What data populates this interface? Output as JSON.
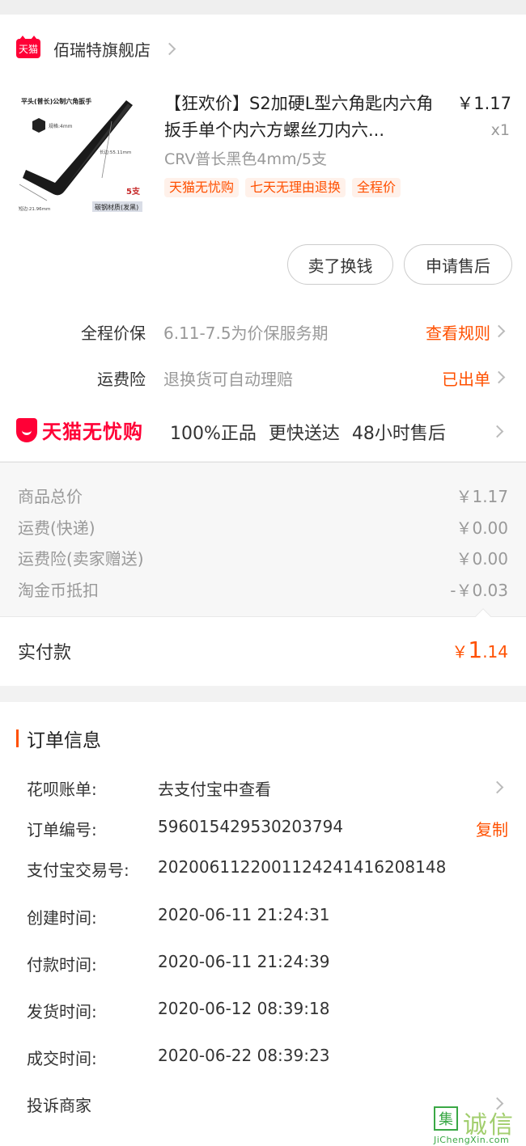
{
  "store": {
    "badge": "天猫",
    "name": "佰瑞特旗舰店"
  },
  "product": {
    "image_texts": {
      "heading": "平头(普长)公制六角扳手",
      "spec": "规格:4mm",
      "long_side": "长边:55.11mm",
      "short_side": "短边:21.96mm",
      "count": "5支",
      "material": "碳钢材质(发黑)"
    },
    "title": "【狂欢价】S2加硬L型六角匙内六角扳手单个内六方螺丝刀内六...",
    "price": "￥1.17",
    "qty": "x1",
    "sku": "CRV普长黑色4mm/5支",
    "tags": [
      "天猫无忧购",
      "七天无理由退换",
      "全程价"
    ]
  },
  "buttons": {
    "sell": "卖了换钱",
    "after_sale": "申请售后"
  },
  "services": [
    {
      "label": "全程价保",
      "desc": "6.11-7.5为价保服务期",
      "link": "查看规则"
    },
    {
      "label": "运费险",
      "desc": "退换货可自动理赔",
      "link": "已出单"
    }
  ],
  "wuyou": {
    "logo_text": "天猫无忧购",
    "features": "100%正品  更快送达  48小时售后"
  },
  "costs": [
    {
      "label": "商品总价",
      "value": "￥1.17"
    },
    {
      "label": "运费(快递)",
      "value": "￥0.00"
    },
    {
      "label": "运费险(卖家赠送)",
      "value": "￥0.00"
    },
    {
      "label": "淘金币抵扣",
      "value": "-￥0.03"
    }
  ],
  "paid": {
    "label": "实付款",
    "currency": "￥",
    "int": "1",
    "dec": ".14"
  },
  "order_info": {
    "title": "订单信息",
    "rows": [
      {
        "label": "花呗账单:",
        "value": "去支付宝中查看"
      },
      {
        "label": "订单编号:",
        "value": "596015429530203794",
        "action": "复制"
      },
      {
        "label": "支付宝交易号:",
        "value": "2020061122001124241416208148"
      },
      {
        "label": "创建时间:",
        "value": "2020-06-11 21:24:31"
      },
      {
        "label": "付款时间:",
        "value": "2020-06-11 21:24:39"
      },
      {
        "label": "发货时间:",
        "value": "2020-06-12 08:39:18"
      },
      {
        "label": "成交时间:",
        "value": "2020-06-22 08:39:23"
      },
      {
        "label": "投诉商家",
        "value": ""
      }
    ]
  },
  "watermark": {
    "char1": "集",
    "chars": "诚信",
    "url": "JiChengXin.com"
  },
  "colors": {
    "accent": "#ff5000",
    "tmall_red": "#ff0036",
    "text_gray": "#999999"
  }
}
